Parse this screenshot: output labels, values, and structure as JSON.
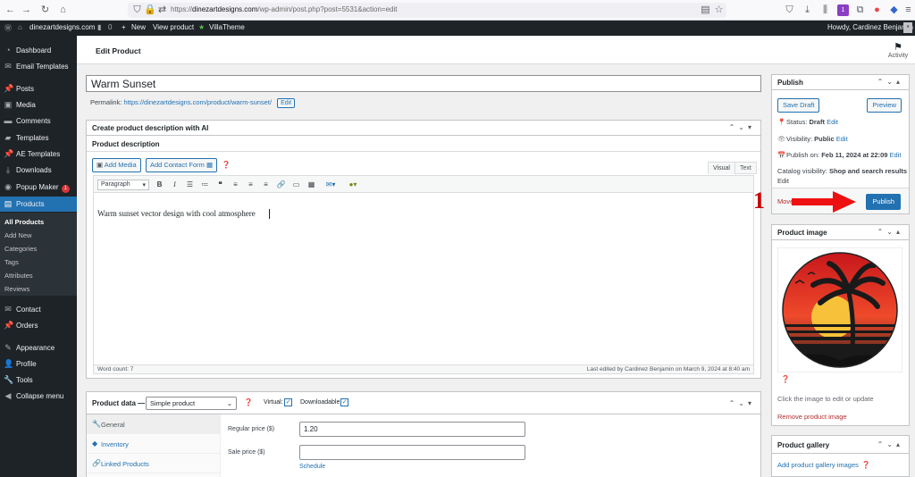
{
  "browser": {
    "url_prefix": "https://",
    "url_domain": "dinezartdesigns.com",
    "url_path": "/wp-admin/post.php?post=5531&action=edit",
    "ext_badge": "1"
  },
  "admin_bar": {
    "site_name": "dinezartdesigns.com",
    "comments_count": "0",
    "new_label": "New",
    "view_product": "View product",
    "villatheme": "VillaTheme",
    "howdy": "Howdy, Cardinez Benjamin"
  },
  "sidebar": {
    "items": [
      {
        "label": "Dashboard",
        "icon": "dashboard-icon"
      },
      {
        "label": "Email Templates",
        "icon": "email-icon"
      },
      {
        "label": "Posts",
        "icon": "pin-icon"
      },
      {
        "label": "Media",
        "icon": "media-icon"
      },
      {
        "label": "Comments",
        "icon": "comment-icon"
      },
      {
        "label": "Templates",
        "icon": "folder-icon"
      },
      {
        "label": "AE Templates",
        "icon": "pin-icon"
      },
      {
        "label": "Downloads",
        "icon": "download-icon"
      },
      {
        "label": "Popup Maker",
        "icon": "popup-icon",
        "badge": "1"
      },
      {
        "label": "Products",
        "icon": "archive-icon"
      },
      {
        "label": "Contact",
        "icon": "mail-icon"
      },
      {
        "label": "Orders",
        "icon": "pin-icon"
      },
      {
        "label": "Appearance",
        "icon": "brush-icon"
      },
      {
        "label": "Profile",
        "icon": "user-icon"
      },
      {
        "label": "Tools",
        "icon": "wrench-icon"
      },
      {
        "label": "Collapse menu",
        "icon": "collapse-icon"
      }
    ],
    "submenu": [
      "All Products",
      "Add New",
      "Categories",
      "Tags",
      "Attributes",
      "Reviews"
    ]
  },
  "header": {
    "title": "Edit Product",
    "activity": "Activity"
  },
  "post": {
    "title": "Warm Sunset",
    "permalink_label": "Permalink:",
    "permalink_url": "https://dinezartdesigns.com/product/warm-sunset/",
    "edit_label": "Edit"
  },
  "ai_box": {
    "title": "Create product description with AI"
  },
  "editor": {
    "section_label": "Product description",
    "add_media": "Add Media",
    "add_contact_form": "Add Contact Form",
    "tab_visual": "Visual",
    "tab_text": "Text",
    "paragraph": "Paragraph",
    "content": "Warm sunset vector design with cool atmosphere",
    "word_count": "Word count: 7",
    "last_edited": "Last edited by Cardinez Benjamin on March 9, 2024 at 8:40 am"
  },
  "product_data": {
    "title": "Product data —",
    "type": "Simple product",
    "virtual_label": "Virtual:",
    "downloadable_label": "Downloadable:",
    "tabs": [
      "General",
      "Inventory",
      "Linked Products"
    ],
    "regular_price_label": "Regular price ($)",
    "regular_price": "1.20",
    "sale_price_label": "Sale price ($)",
    "sale_price": "",
    "schedule": "Schedule"
  },
  "publish": {
    "title": "Publish",
    "save_draft": "Save Draft",
    "preview": "Preview",
    "status_label": "Status:",
    "status": "Draft",
    "visibility_label": "Visibility:",
    "visibility": "Public",
    "publish_on_label": "Publish on:",
    "publish_on": "Feb 11, 2024 at 22:09",
    "catalog_label": "Catalog visibility:",
    "catalog": "Shop and search results",
    "edit": "Edit",
    "move_trash": "Move",
    "publish_btn": "Publish"
  },
  "product_image": {
    "title": "Product image",
    "hint": "Click the image to edit or update",
    "remove": "Remove product image"
  },
  "gallery": {
    "title": "Product gallery",
    "add": "Add product gallery images"
  },
  "annotation": {
    "number": "1",
    "color": "#cc0000"
  },
  "colors": {
    "accent": "#2271b1",
    "admin_dark": "#1d2327"
  }
}
